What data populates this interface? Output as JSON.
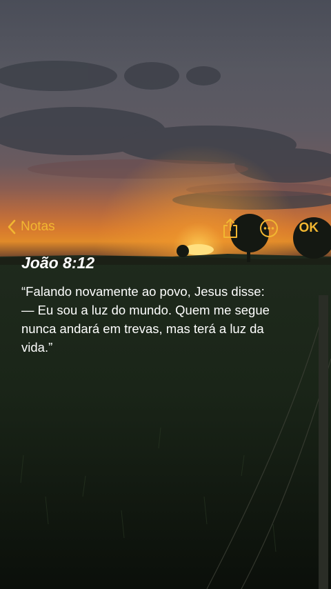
{
  "nav": {
    "back_label": "Notas",
    "done_label": "OK",
    "icons": [
      "chevron-left-icon",
      "share-icon",
      "more-icon"
    ],
    "accent_color": "#f2b731"
  },
  "note": {
    "title": "João 8:12",
    "body": "“Falando novamente ao povo, Jesus disse:\n— Eu sou a luz do mundo. Quem me segue\nnunca andará em trevas, mas terá a luz da\nvida.”"
  }
}
